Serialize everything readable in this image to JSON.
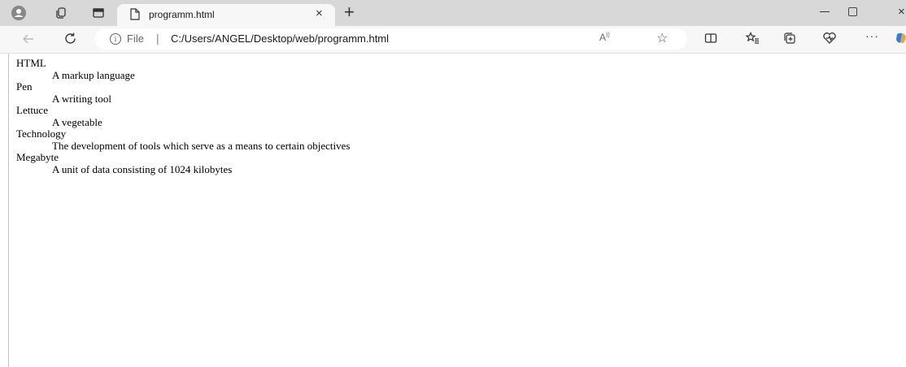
{
  "tab": {
    "title": "programm.html",
    "close_glyph": "×",
    "new_tab_glyph": "+"
  },
  "window_controls": {
    "close_glyph": "×"
  },
  "address_bar": {
    "scheme_label": "File",
    "separator": "|",
    "url": "C:/Users/ANGEL/Desktop/web/programm.html"
  },
  "toolbar": {
    "read_aloud_label": "A",
    "more_label": "···"
  },
  "icons": [
    "profile-icon",
    "workspaces-icon",
    "tab-actions-icon",
    "page-icon",
    "back-icon",
    "refresh-icon",
    "info-icon",
    "read-aloud-icon",
    "favorite-star-icon",
    "split-screen-icon",
    "favorites-icon",
    "collections-icon",
    "performance-icon",
    "more-icon",
    "copilot-icon"
  ],
  "content": {
    "terms": [
      {
        "term": "HTML",
        "definition": "A markup language"
      },
      {
        "term": "Pen",
        "definition": "A writing tool"
      },
      {
        "term": "Lettuce",
        "definition": "A vegetable"
      },
      {
        "term": "Technology",
        "definition": "The development of tools which serve as a means to certain objectives"
      },
      {
        "term": "Megabyte",
        "definition": "A unit of data consisting of 1024 kilobytes"
      }
    ]
  }
}
